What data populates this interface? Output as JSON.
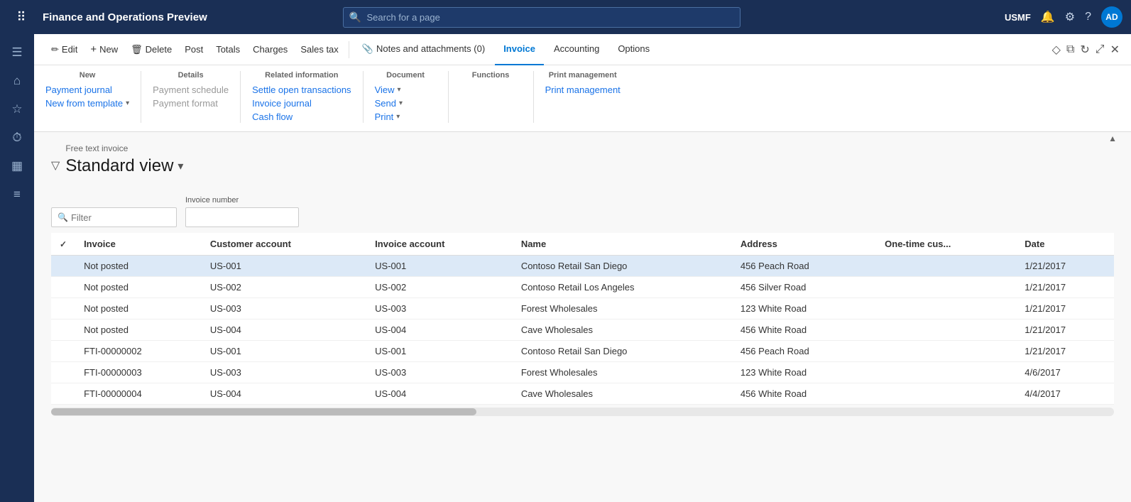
{
  "app": {
    "title": "Finance and Operations Preview",
    "user": "USMF",
    "avatar_initials": "AD"
  },
  "search": {
    "placeholder": "Search for a page"
  },
  "toolbar": {
    "buttons": [
      {
        "id": "edit",
        "label": "Edit",
        "icon": "✏️"
      },
      {
        "id": "new",
        "label": "New",
        "icon": "+"
      },
      {
        "id": "delete",
        "label": "Delete",
        "icon": "🗑"
      },
      {
        "id": "post",
        "label": "Post",
        "icon": ""
      },
      {
        "id": "totals",
        "label": "Totals",
        "icon": ""
      },
      {
        "id": "charges",
        "label": "Charges",
        "icon": ""
      },
      {
        "id": "salestax",
        "label": "Sales tax",
        "icon": ""
      }
    ],
    "tabs": [
      {
        "id": "notes",
        "label": "Notes and attachments (0)",
        "icon": "📎"
      },
      {
        "id": "invoice",
        "label": "Invoice",
        "active": true
      },
      {
        "id": "accounting",
        "label": "Accounting"
      },
      {
        "id": "options",
        "label": "Options"
      }
    ]
  },
  "ribbon": {
    "groups": [
      {
        "title": "New",
        "items": [
          {
            "label": "Payment journal",
            "disabled": false
          },
          {
            "label": "New from template",
            "disabled": false,
            "has_chevron": true
          }
        ]
      },
      {
        "title": "Details",
        "items": [
          {
            "label": "Payment schedule",
            "disabled": true
          },
          {
            "label": "Payment format",
            "disabled": true
          }
        ]
      },
      {
        "title": "Related information",
        "items": [
          {
            "label": "Settle open transactions",
            "disabled": false
          },
          {
            "label": "Invoice journal",
            "disabled": false
          },
          {
            "label": "Cash flow",
            "disabled": false
          }
        ]
      },
      {
        "title": "Document",
        "items": [
          {
            "label": "View",
            "disabled": false,
            "has_chevron": true
          },
          {
            "label": "Send",
            "disabled": false,
            "has_chevron": true
          },
          {
            "label": "Print",
            "disabled": false,
            "has_chevron": true
          }
        ]
      },
      {
        "title": "Functions",
        "items": []
      },
      {
        "title": "Print management",
        "items": [
          {
            "label": "Print management",
            "disabled": false
          }
        ]
      }
    ]
  },
  "content": {
    "breadcrumb": "Free text invoice",
    "view_title": "Standard view",
    "filter_placeholder": "Filter",
    "invoice_number_label": "Invoice number",
    "invoice_number_value": "",
    "table": {
      "columns": [
        {
          "id": "check",
          "label": "✓"
        },
        {
          "id": "invoice",
          "label": "Invoice"
        },
        {
          "id": "customer_account",
          "label": "Customer account"
        },
        {
          "id": "invoice_account",
          "label": "Invoice account"
        },
        {
          "id": "name",
          "label": "Name"
        },
        {
          "id": "address",
          "label": "Address"
        },
        {
          "id": "one_time_cus",
          "label": "One-time cus..."
        },
        {
          "id": "date",
          "label": "Date"
        }
      ],
      "rows": [
        {
          "selected": true,
          "invoice": "Not posted",
          "customer_account": "US-001",
          "invoice_account": "US-001",
          "name": "Contoso Retail San Diego",
          "address": "456 Peach Road",
          "one_time_cus": "",
          "date": "1/21/2017",
          "invoice_is_link": true,
          "customer_is_link": true,
          "invoice_account_is_link": true,
          "name_is_link": true
        },
        {
          "selected": false,
          "invoice": "Not posted",
          "customer_account": "US-002",
          "invoice_account": "US-002",
          "name": "Contoso Retail Los Angeles",
          "address": "456 Silver Road",
          "one_time_cus": "",
          "date": "1/21/2017",
          "invoice_is_link": true,
          "customer_is_link": false,
          "invoice_account_is_link": false,
          "name_is_link": false
        },
        {
          "selected": false,
          "invoice": "Not posted",
          "customer_account": "US-003",
          "invoice_account": "US-003",
          "name": "Forest Wholesales",
          "address": "123 White Road",
          "one_time_cus": "",
          "date": "1/21/2017",
          "invoice_is_link": true,
          "customer_is_link": false,
          "invoice_account_is_link": false,
          "name_is_link": false
        },
        {
          "selected": false,
          "invoice": "Not posted",
          "customer_account": "US-004",
          "invoice_account": "US-004",
          "name": "Cave Wholesales",
          "address": "456 White Road",
          "one_time_cus": "",
          "date": "1/21/2017",
          "invoice_is_link": true,
          "customer_is_link": false,
          "invoice_account_is_link": false,
          "name_is_link": false
        },
        {
          "selected": false,
          "invoice": "FTI-00000002",
          "customer_account": "US-001",
          "invoice_account": "US-001",
          "name": "Contoso Retail San Diego",
          "address": "456 Peach Road",
          "one_time_cus": "",
          "date": "1/21/2017",
          "invoice_is_link": true,
          "customer_is_link": false,
          "invoice_account_is_link": false,
          "name_is_link": false
        },
        {
          "selected": false,
          "invoice": "FTI-00000003",
          "customer_account": "US-003",
          "invoice_account": "US-003",
          "name": "Forest Wholesales",
          "address": "123 White Road",
          "one_time_cus": "",
          "date": "4/6/2017",
          "invoice_is_link": true,
          "customer_is_link": false,
          "invoice_account_is_link": false,
          "name_is_link": false
        },
        {
          "selected": false,
          "invoice": "FTI-00000004",
          "customer_account": "US-004",
          "invoice_account": "US-004",
          "name": "Cave Wholesales",
          "address": "456 White Road",
          "one_time_cus": "",
          "date": "4/4/2017",
          "invoice_is_link": true,
          "customer_is_link": false,
          "invoice_account_is_link": false,
          "name_is_link": false
        }
      ]
    }
  },
  "sidebar": {
    "icons": [
      {
        "id": "menu",
        "symbol": "☰"
      },
      {
        "id": "home",
        "symbol": "⌂"
      },
      {
        "id": "favorites",
        "symbol": "★"
      },
      {
        "id": "recent",
        "symbol": "⏱"
      },
      {
        "id": "workspace",
        "symbol": "⊞"
      },
      {
        "id": "list",
        "symbol": "≡"
      }
    ]
  }
}
